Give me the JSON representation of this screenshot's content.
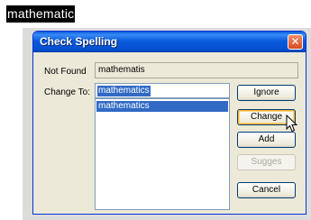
{
  "document": {
    "highlighted_word": "mathematic"
  },
  "dialog": {
    "title": "Check Spelling",
    "close_icon": "close-x-icon",
    "not_found_label": "Not Found",
    "not_found_value": "mathematis",
    "change_to_label": "Change To:",
    "change_to_value": "mathematics",
    "suggestions": [
      "mathematics"
    ],
    "selected_suggestion_index": 0,
    "buttons": {
      "ignore": "Ignore",
      "change": "Change",
      "add": "Add",
      "suggest": "Sugges",
      "cancel": "Cancel"
    }
  },
  "colors": {
    "titlebar": "#0a5bdc",
    "selection": "#316ac5",
    "dialog_bg": "#ece9d8"
  }
}
